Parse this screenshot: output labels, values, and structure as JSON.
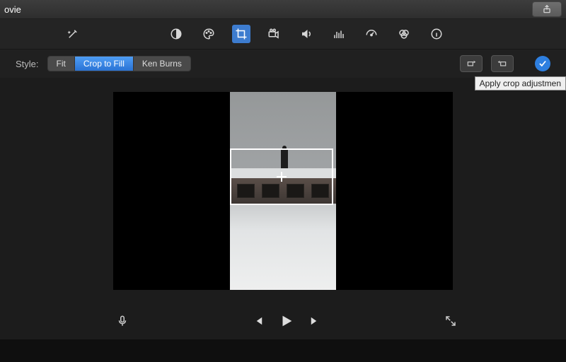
{
  "titlebar": {
    "title": "ovie"
  },
  "style": {
    "label": "Style:",
    "options": [
      "Fit",
      "Crop to Fill",
      "Ken Burns"
    ],
    "selected": 1
  },
  "tooltip": "Apply crop adjustmen",
  "toolbar": {
    "active": "crop"
  }
}
